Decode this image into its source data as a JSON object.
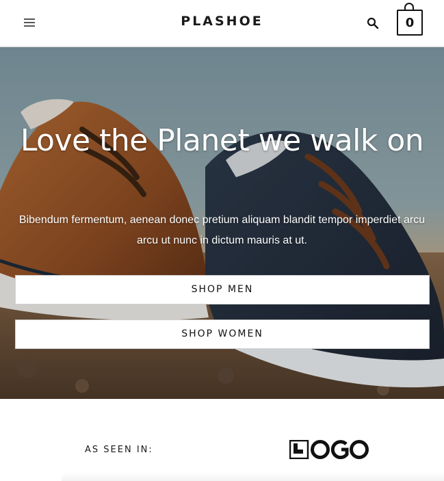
{
  "header": {
    "brand": "PLASHOE",
    "cart_count": "0",
    "menu_icon": "hamburger-icon",
    "search_icon": "search-icon",
    "cart_icon": "shopping-bag-icon"
  },
  "hero": {
    "title": "Love the Planet we walk on",
    "text": "Bibendum fermentum, aenean donec pretium aliquam blandit tempor imperdiet arcu arcu ut nunc in dictum mauris at ut.",
    "cta_primary": "SHOP MEN",
    "cta_secondary": "SHOP WOMEN"
  },
  "press": {
    "label": "AS SEEN IN:",
    "logo_text": "LOGO"
  },
  "colors": {
    "text": "#111111",
    "header_border": "#cfcfcf",
    "hero_text": "#ffffff",
    "button_bg": "#ffffff"
  }
}
